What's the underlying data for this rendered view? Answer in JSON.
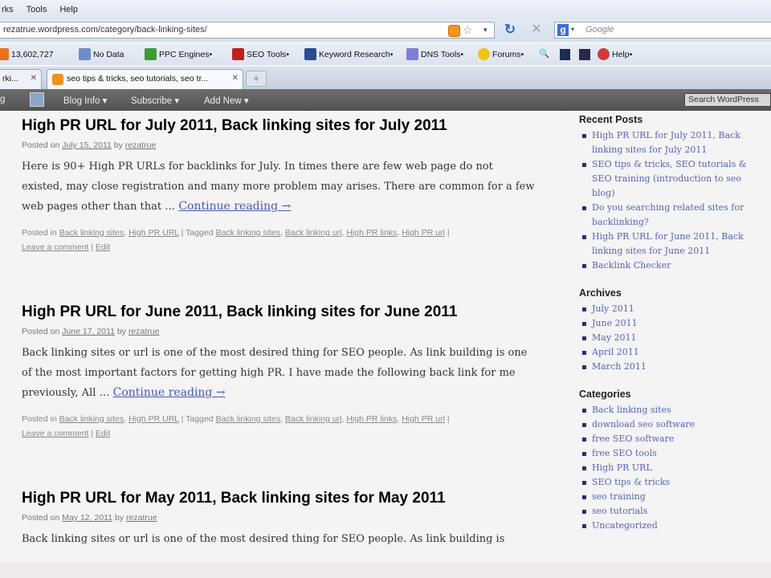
{
  "browser": {
    "menu": [
      "rks",
      "Tools",
      "Help"
    ],
    "url": "rezatrue.wordpress.com/category/back-linking-sites/",
    "search_placeholder": "Google",
    "bookmarks": [
      "13,602,727",
      "No Data",
      "PPC Engines•",
      "SEO Tools•",
      "Keyword Research•",
      "DNS Tools•",
      "Forums•",
      "Help•"
    ],
    "tabs": [
      {
        "label": "rki..."
      },
      {
        "label": "seo tips & tricks, seo tutorials, seo tr..."
      }
    ],
    "new_tab": "+"
  },
  "adminbar": {
    "left_label": "g",
    "blog_info": "Blog Info ▾",
    "subscribe": "Subscribe ▾",
    "add_new": "Add New ▾",
    "search_placeholder": "Search WordPress"
  },
  "posts": [
    {
      "title": "High PR URL for July 2011, Back linking sites for July 2011",
      "posted_on": "Posted on",
      "date": "July 15, 2011",
      "by": "by",
      "author": "rezatrue",
      "excerpt": "Here is 90+ High PR URLs for backlinks for July. In times there are few web page do not existed, may close registration and many more problem may arises. There are common for a few web pages other than that … ",
      "continue": "Continue reading →",
      "posted_in": "Posted in",
      "categories": [
        "Back linking sites",
        "High PR URL"
      ],
      "tagged": "| Tagged",
      "tags": [
        "Back linking sites",
        "Back linking url",
        "High PR links",
        "High PR url"
      ],
      "comment": "Leave a comment",
      "edit": "Edit"
    },
    {
      "title": "High PR URL for June 2011, Back linking sites for June 2011",
      "posted_on": "Posted on",
      "date": "June 17, 2011",
      "by": "by",
      "author": "rezatrue",
      "excerpt": "Back linking sites or url is one of the most desired thing for SEO people. As link building is one of the most important factors for getting high PR. I have made the following back link for me previously, All … ",
      "continue": "Continue reading →",
      "posted_in": "Posted in",
      "categories": [
        "Back linking sites",
        "High PR URL"
      ],
      "tagged": "| Tagged",
      "tags": [
        "Back linking sites",
        "Back linking url",
        "High PR links",
        "High PR url"
      ],
      "comment": "Leave a comment",
      "edit": "Edit"
    },
    {
      "title": "High PR URL for May 2011, Back linking sites for May 2011",
      "posted_on": "Posted on",
      "date": "May 12, 2011",
      "by": "by",
      "author": "rezatrue",
      "excerpt": "Back linking sites or url is one of the most desired thing for SEO people.  As link building is"
    }
  ],
  "sidebar": {
    "recent_posts_title": "Recent Posts",
    "recent_posts": [
      "High PR URL for July 2011, Back linking sites for July 2011",
      "SEO tips & tricks, SEO tutorials & SEO training (introduction to seo blog)",
      "Do you searching related sites for backlinking?",
      "High PR URL for June 2011, Back linking sites for June 2011",
      "Backlink Checker"
    ],
    "archives_title": "Archives",
    "archives": [
      "July 2011",
      "June 2011",
      "May 2011",
      "April 2011",
      "March 2011"
    ],
    "categories_title": "Categories",
    "categories": [
      "Back linking sites",
      "download seo software",
      "free SEO software",
      "free SEO tools",
      "High PR URL",
      "SEO tips & tricks",
      "seo training",
      "seo tutorials",
      "Uncategorized"
    ]
  },
  "colors": {
    "link": "#4658b8",
    "admin_bar": "#5e5e5e",
    "sidebar_link": "#5564b8"
  }
}
